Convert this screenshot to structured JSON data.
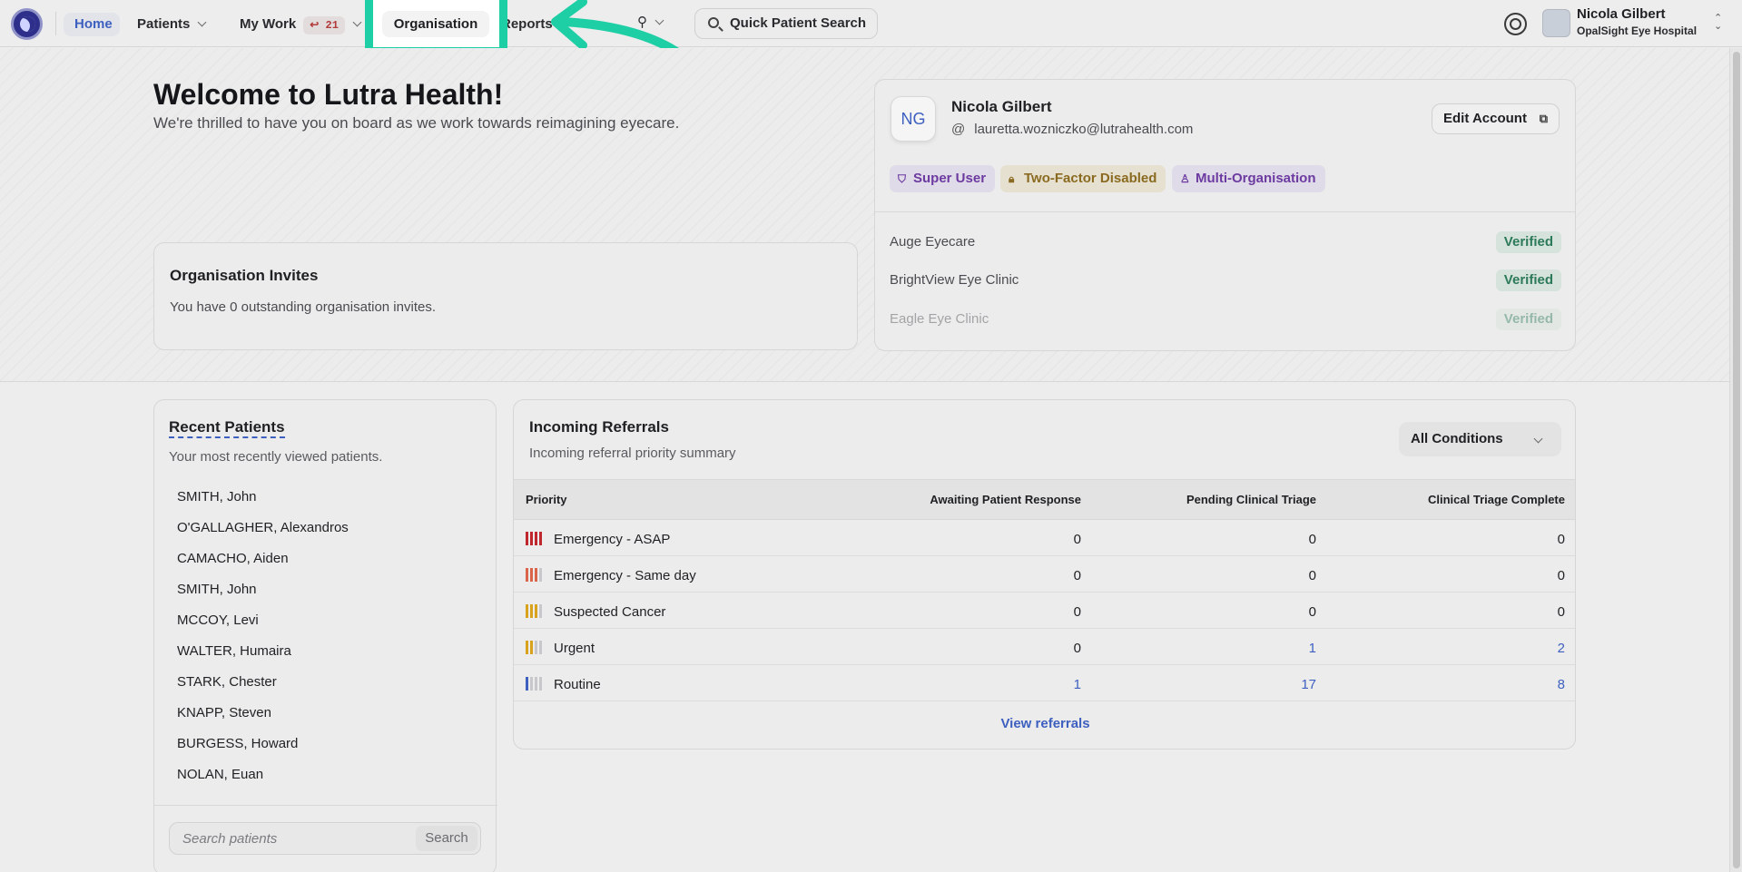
{
  "nav": {
    "home": "Home",
    "patients": "Patients",
    "my_work": "My Work",
    "my_work_badge": "21",
    "organisation": "Organisation",
    "reports": "Reports",
    "quick_search": "Quick Patient Search",
    "user_name": "Nicola Gilbert",
    "user_org": "OpalSight Eye Hospital"
  },
  "welcome": {
    "title": "Welcome to Lutra Health!",
    "subtitle": "We're thrilled to have you on board as we work towards reimagining eyecare."
  },
  "invites": {
    "title": "Organisation Invites",
    "text": "You have 0 outstanding organisation invites."
  },
  "account": {
    "initials": "NG",
    "name": "Nicola Gilbert",
    "email": "lauretta.wozniczko@lutrahealth.com",
    "edit_label": "Edit Account",
    "tags": [
      "Super User",
      "Two-Factor Disabled",
      "Multi-Organisation"
    ],
    "orgs": [
      {
        "name": "Auge Eyecare",
        "status": "Verified"
      },
      {
        "name": "BrightView Eye Clinic",
        "status": "Verified"
      },
      {
        "name": "Eagle Eye Clinic",
        "status": "Verified"
      }
    ]
  },
  "recent": {
    "title": "Recent Patients",
    "subtitle": "Your most recently viewed patients.",
    "patients": [
      "SMITH, John",
      "O'GALLAGHER, Alexandros",
      "CAMACHO, Aiden",
      "SMITH, John",
      "MCCOY, Levi",
      "WALTER, Humaira",
      "STARK, Chester",
      "KNAPP, Steven",
      "BURGESS, Howard",
      "NOLAN, Euan"
    ],
    "search_placeholder": "Search patients",
    "search_button": "Search"
  },
  "referrals": {
    "title": "Incoming Referrals",
    "subtitle": "Incoming referral priority summary",
    "filter": "All Conditions",
    "columns": [
      "Priority",
      "Awaiting Patient Response",
      "Pending Clinical Triage",
      "Clinical Triage Complete"
    ],
    "rows": [
      {
        "priority": "Emergency - ASAP",
        "awaiting": "0",
        "pending": "0",
        "complete": "0",
        "color": "#c0262d",
        "level": 4
      },
      {
        "priority": "Emergency - Same day",
        "awaiting": "0",
        "pending": "0",
        "complete": "0",
        "color": "#d9654a",
        "level": 3
      },
      {
        "priority": "Suspected Cancer",
        "awaiting": "0",
        "pending": "0",
        "complete": "0",
        "color": "#d9a21c",
        "level": 3
      },
      {
        "priority": "Urgent",
        "awaiting": "0",
        "pending": "1",
        "complete": "2",
        "color": "#d9a21c",
        "level": 2
      },
      {
        "priority": "Routine",
        "awaiting": "1",
        "pending": "17",
        "complete": "8",
        "color": "#3d5fbf",
        "level": 1
      }
    ],
    "view_link": "View referrals"
  }
}
